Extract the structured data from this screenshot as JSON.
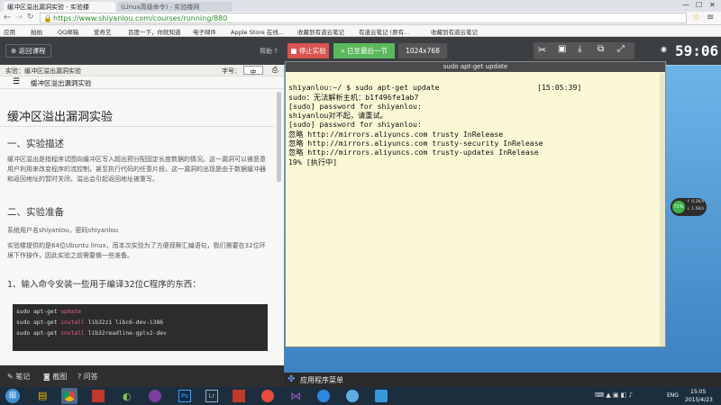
{
  "browser": {
    "tabs": [
      {
        "label": "缓冲区溢出漏洞实验 - 实验楼"
      },
      {
        "label": "(Linux高级命令) - 实验楼网"
      }
    ],
    "url": "https://www.shiyanlou.com/courses/running/880",
    "bookmarks": [
      "应用",
      "拍拍",
      "QQ邮箱",
      "爱奇艺",
      "百度一下，你就知道",
      "电子邮件",
      "Apple Store 在线...",
      "收藏到有道云笔记",
      "有道云笔记 (原有...",
      "收藏到有道云笔记"
    ]
  },
  "toolbar": {
    "back": "返回课程",
    "help": "帮助 ?",
    "stop": "停止实验",
    "save": "已至最后一节",
    "resolution": "1024x768",
    "timer": "59:06"
  },
  "left": {
    "subtitle": "实验：缓冲区溢出漏洞实验",
    "font_label": "字号：",
    "font_value": "中",
    "toc_title": "缓冲区溢出漏洞实验",
    "title": "缓冲区溢出漏洞实验",
    "h1": "一、实验描述",
    "p1": "缓冲区溢出是指程序试图向缓冲区写入超出预分配固定长度数据的情况。这一漏洞可以被恶意用户利用来改变程序的流控制，甚至执行代码的任意片段。这一漏洞的出现是由于数据缓冲器和返回地址的暂时关闭，溢出会引起返回地址被重写。",
    "h2": "二、实验准备",
    "p2": "系统用户名shiyanlou，密码shiyanlou",
    "p3": "实验楼提供的是64位Ubuntu linux，而本次实验为了方便观察汇编语句，我们需要在32位环境下作操作，因此实验之前需要做一些准备。",
    "h3": "1、输入命令安装一些用于编译32位C程序的东西：",
    "code": [
      {
        "pre": "sudo apt-get ",
        "kw": "update",
        "post": ""
      },
      {
        "pre": "sudo apt-get ",
        "kw": "install",
        "post": " lib32z1 libc6-dev-i386"
      },
      {
        "pre": "sudo apt-get ",
        "kw": "install",
        "post": " lib32readline-gplv2-dev"
      }
    ],
    "footer": [
      "笔记",
      "截图",
      "问答"
    ]
  },
  "terminal": {
    "title": "sudo apt-get update",
    "lines": [
      "shiyanlou:~/ $ sudo apt-get update                      [15:05:39]",
      "sudo：无法解析主机：b1f496fe1ab7",
      "[sudo] password for shiyanlou:",
      "shiyanlou对不起，请重试。",
      "[sudo] password for shiyanlou:",
      "忽略 http://mirrors.aliyuncs.com trusty InRelease",
      "忽略 http://mirrors.aliyuncs.com trusty-security InRelease",
      "忽略 http://mirrors.aliyuncs.com trusty-updates InRelease",
      "19% [执行中]"
    ]
  },
  "desktop": {
    "menu": "应用程序菜单",
    "net_pct": "71%",
    "net_up": "0.2K/s",
    "net_down": "1.5K/s"
  },
  "taskbar": {
    "ime": "ENG",
    "time": "15:05",
    "date": "2015/4/23"
  }
}
